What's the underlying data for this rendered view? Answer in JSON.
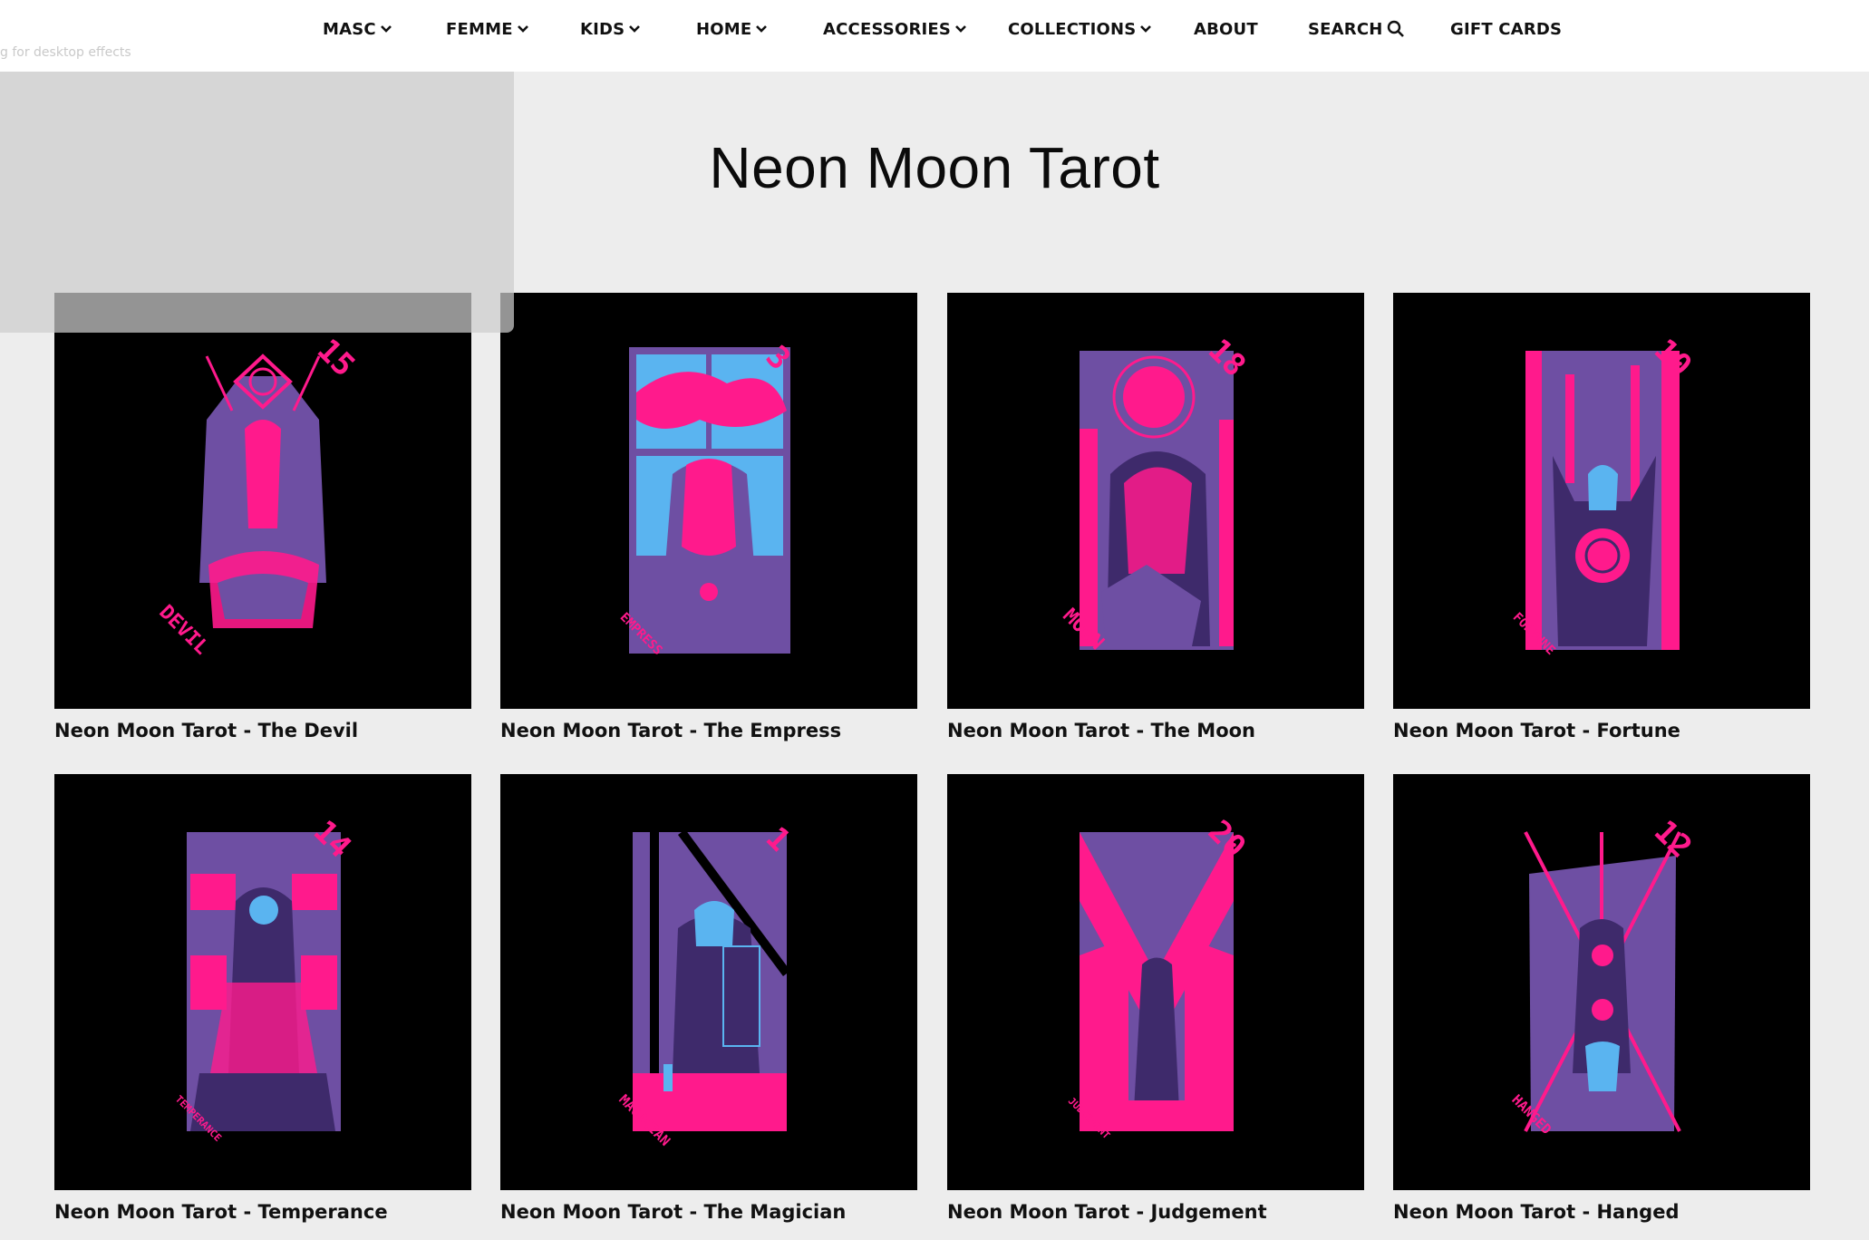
{
  "nav": {
    "items": [
      {
        "label": "MASC",
        "dropdown": true
      },
      {
        "label": "FEMME",
        "dropdown": true
      },
      {
        "label": "KIDS",
        "dropdown": true
      },
      {
        "label": "HOME",
        "dropdown": true
      },
      {
        "label": "ACCESSORIES",
        "dropdown": true
      },
      {
        "label": "COLLECTIONS",
        "dropdown": true
      },
      {
        "label": "ABOUT",
        "dropdown": false
      },
      {
        "label": "SEARCH",
        "dropdown": false,
        "icon": "search-icon"
      },
      {
        "label": "GIFT CARDS",
        "dropdown": false
      }
    ]
  },
  "overlay": {
    "hint": "g for desktop effects"
  },
  "page": {
    "title": "Neon Moon Tarot"
  },
  "products": [
    {
      "title": "Neon Moon Tarot - The Devil",
      "card_label": "DEVIL",
      "card_number": "15"
    },
    {
      "title": "Neon Moon Tarot - The Empress",
      "card_label": "EMPRESS",
      "card_number": "3"
    },
    {
      "title": "Neon Moon Tarot - The Moon",
      "card_label": "MOON",
      "card_number": "18"
    },
    {
      "title": "Neon Moon Tarot - Fortune",
      "card_label": "FORTUNE",
      "card_number": "10"
    },
    {
      "title": "Neon Moon Tarot - Temperance",
      "card_label": "TEMPERANCE",
      "card_number": "14"
    },
    {
      "title": "Neon Moon Tarot - The Magician",
      "card_label": "MAGICIAN",
      "card_number": "1"
    },
    {
      "title": "Neon Moon Tarot - Judgement",
      "card_label": "JUDGEMENT",
      "card_number": "20"
    },
    {
      "title": "Neon Moon Tarot - Hanged",
      "card_label": "HANGED",
      "card_number": "12"
    }
  ],
  "colors": {
    "pink": "#ff1a8c",
    "purple": "#6e4fa3",
    "blue": "#5ab4f0",
    "black": "#000000"
  }
}
